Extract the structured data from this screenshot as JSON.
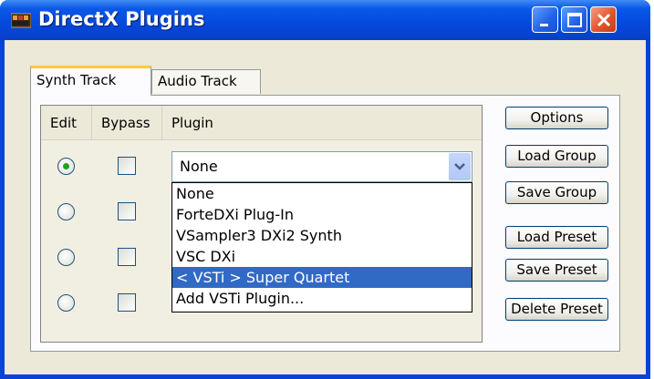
{
  "window": {
    "title": "DirectX Plugins"
  },
  "tabs": [
    {
      "label": "Synth Track",
      "active": true
    },
    {
      "label": "Audio Track",
      "active": false
    }
  ],
  "grid": {
    "columns": [
      "Edit",
      "Bypass",
      "Plugin"
    ],
    "rows": [
      {
        "edit_selected": true,
        "bypass": false,
        "plugin": "None"
      },
      {
        "edit_selected": false,
        "bypass": false,
        "plugin": ""
      },
      {
        "edit_selected": false,
        "bypass": false,
        "plugin": ""
      },
      {
        "edit_selected": false,
        "bypass": false,
        "plugin": ""
      }
    ]
  },
  "plugin_combo": {
    "value": "None",
    "options": [
      "None",
      "ForteDXi Plug-In",
      "VSampler3 DXi2 Synth",
      "VSC DXi",
      "< VSTi > Super Quartet",
      "Add VSTi Plugin..."
    ],
    "highlighted_index": 4
  },
  "buttons": {
    "options": "Options",
    "load_group": "Load Group",
    "save_group": "Save Group",
    "load_preset": "Load Preset",
    "save_preset": "Save Preset",
    "delete_preset": "Delete Preset"
  },
  "colors": {
    "titlebar": "#0548dc",
    "selection": "#316ac5",
    "face": "#ece9d8",
    "close_button": "#e2542c"
  }
}
